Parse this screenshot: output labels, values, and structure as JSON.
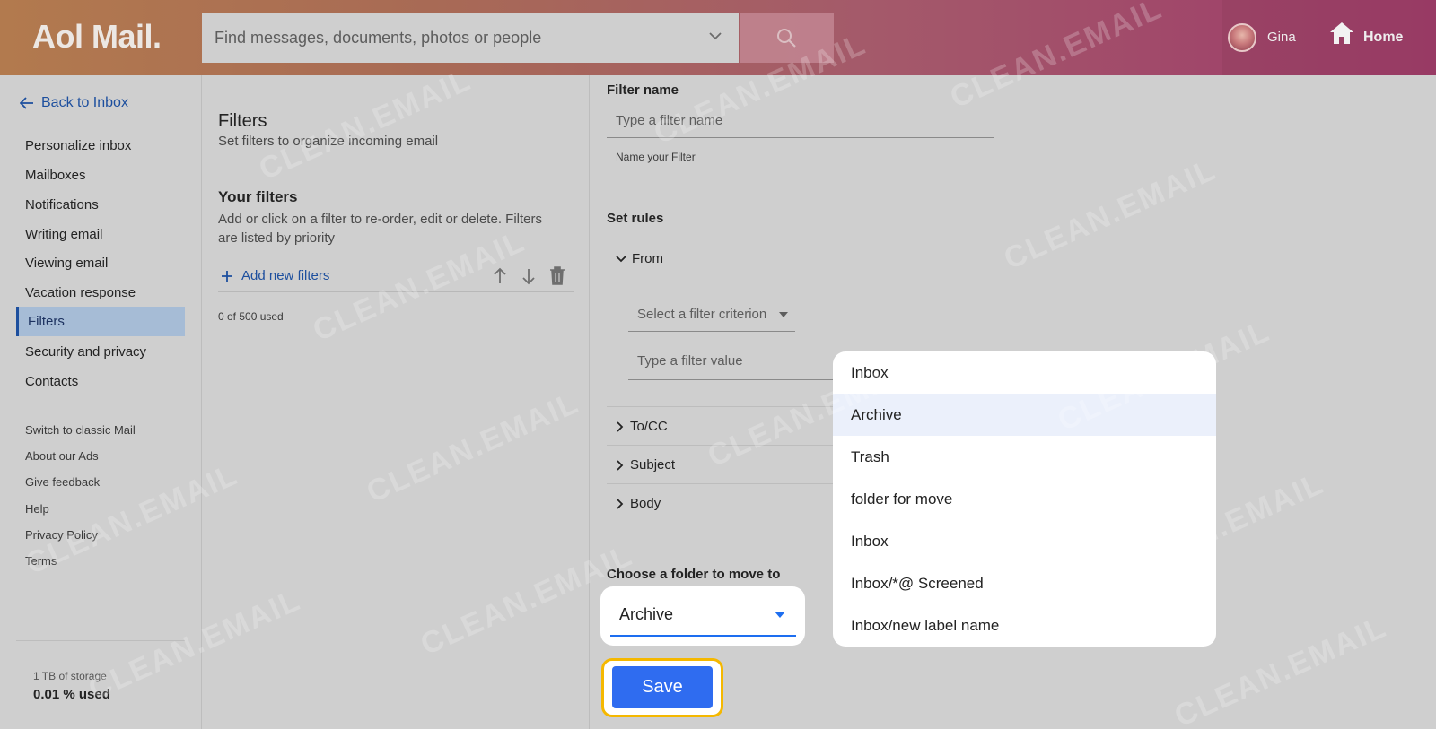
{
  "header": {
    "logo_main": "Aol Mail",
    "logo_dot": ".",
    "search_placeholder": "Find messages, documents, photos or people",
    "user_name": "Gina",
    "home_label": "Home"
  },
  "sidebar": {
    "back_label": "Back to Inbox",
    "items": [
      {
        "label": "Personalize inbox"
      },
      {
        "label": "Mailboxes"
      },
      {
        "label": "Notifications"
      },
      {
        "label": "Writing email"
      },
      {
        "label": "Viewing email"
      },
      {
        "label": "Vacation response"
      },
      {
        "label": "Filters"
      },
      {
        "label": "Security and privacy"
      },
      {
        "label": "Contacts"
      }
    ],
    "links": [
      {
        "label": "Switch to classic Mail"
      },
      {
        "label": "About our Ads"
      },
      {
        "label": "Give feedback"
      },
      {
        "label": "Help"
      },
      {
        "label": "Privacy Policy"
      },
      {
        "label": "Terms"
      }
    ],
    "storage_total": "1 TB of storage",
    "storage_used": "0.01 % used"
  },
  "filters": {
    "title": "Filters",
    "subtitle": "Set filters to organize incoming email",
    "your_filters_title": "Your filters",
    "your_filters_desc": "Add or click on a filter to re-order, edit or delete. Filters are listed by priority",
    "add_label": "Add new filters",
    "used_count": "0 of 500 used"
  },
  "editor": {
    "filter_name_label": "Filter name",
    "filter_name_placeholder": "Type a filter name",
    "filter_name_hint": "Name your Filter",
    "set_rules_label": "Set rules",
    "rules": [
      {
        "label": "From"
      },
      {
        "label": "To/CC"
      },
      {
        "label": "Subject"
      },
      {
        "label": "Body"
      }
    ],
    "criterion_placeholder": "Select a filter criterion",
    "value_placeholder": "Type a filter value",
    "folder_label": "Choose a folder to move to",
    "folder_value": "Archive",
    "save_label": "Save"
  },
  "dropdown": {
    "options": [
      {
        "label": "Inbox"
      },
      {
        "label": "Archive"
      },
      {
        "label": "Trash"
      },
      {
        "label": "folder for move"
      },
      {
        "label": "Inbox"
      },
      {
        "label": "Inbox/*@ Screened"
      },
      {
        "label": "Inbox/new label name"
      }
    ],
    "selected": "Archive"
  },
  "watermark": "CLEAN.EMAIL"
}
